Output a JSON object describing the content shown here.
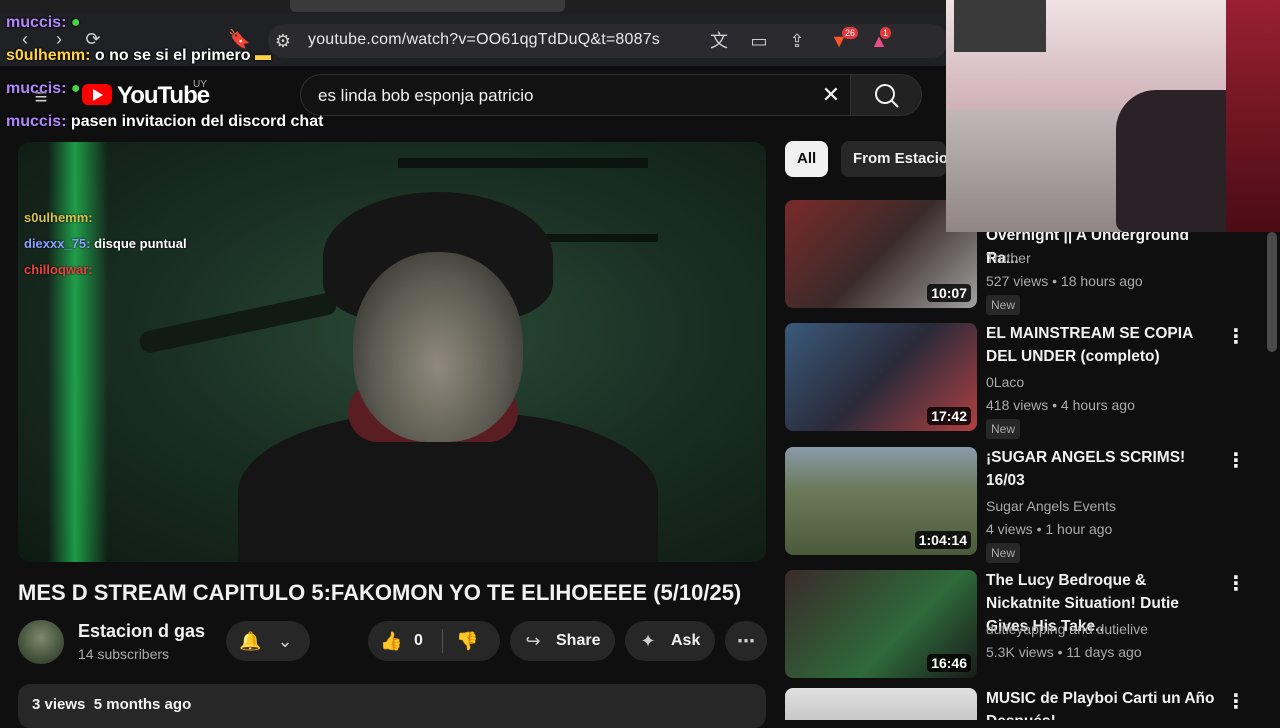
{
  "browser": {
    "url": "youtube.com/watch?v=OO61qgTdDuQ&t=8087s",
    "brave_badge": "26",
    "alert_badge": "1"
  },
  "header": {
    "logo_text": "YouTube",
    "country": "UY",
    "search_value": "es linda bob esponja patricio"
  },
  "chat_overlay": [
    {
      "user": "muccis:",
      "message": "",
      "emote": "frog-emote"
    },
    {
      "user": "s0ulhemm:",
      "message": "o no se si el primero",
      "emote": "car-emote"
    },
    {
      "user": "muccis:",
      "message": "",
      "emote": "frog-emote"
    },
    {
      "user": "muccis:",
      "message": "pasen invitacion del discord chat",
      "emote": ""
    }
  ],
  "video_chat": [
    {
      "user": "s0ulhemm:",
      "message": ""
    },
    {
      "user": "diexxx_75:",
      "message": "disque puntual"
    },
    {
      "user": "chilloqwar:",
      "message": ""
    }
  ],
  "video": {
    "title": "MES D STREAM CAPITULO 5:FAKOMON YO TE ELIHOEEEE (5/10/25)",
    "channel": "Estacion d gas",
    "subscribers": "14 subscribers",
    "likes": "0",
    "share_label": "Share",
    "ask_label": "Ask",
    "views": "3 views",
    "date": "5 months ago"
  },
  "chips": {
    "all": "All",
    "from": "From Estacio"
  },
  "sidebar": [
    {
      "title": "Overnight || A Underground Ra...",
      "channel": "Truther",
      "meta": "527 views • 18 hours ago",
      "badge": "New",
      "duration": "10:07",
      "thumb_color": "#7a2a2a"
    },
    {
      "title": "EL MAINSTREAM SE COPIA DEL UNDER (completo)",
      "channel": "0Laco",
      "meta": "418 views • 4 hours ago",
      "badge": "New",
      "duration": "17:42",
      "thumb_color": "#3a5a7a"
    },
    {
      "title": "¡SUGAR ANGELS SCRIMS! 16/03",
      "channel": "Sugar Angels Events",
      "meta": "4 views • 1 hour ago",
      "badge": "New",
      "duration": "1:04:14",
      "thumb_color": "#6a7a5a"
    },
    {
      "title": "The Lucy Bedroque & Nickatnite Situation! Dutie Gives His Take..",
      "channel": "dutieyapping and dutielive",
      "meta": "5.3K views • 11 days ago",
      "badge": "",
      "duration": "16:46",
      "thumb_color": "#2e6a3a"
    },
    {
      "title": "MUSIC de Playboi Carti un Año Después!",
      "channel": "",
      "meta": "",
      "badge": "",
      "duration": "",
      "thumb_color": "#d8d8d8"
    }
  ]
}
